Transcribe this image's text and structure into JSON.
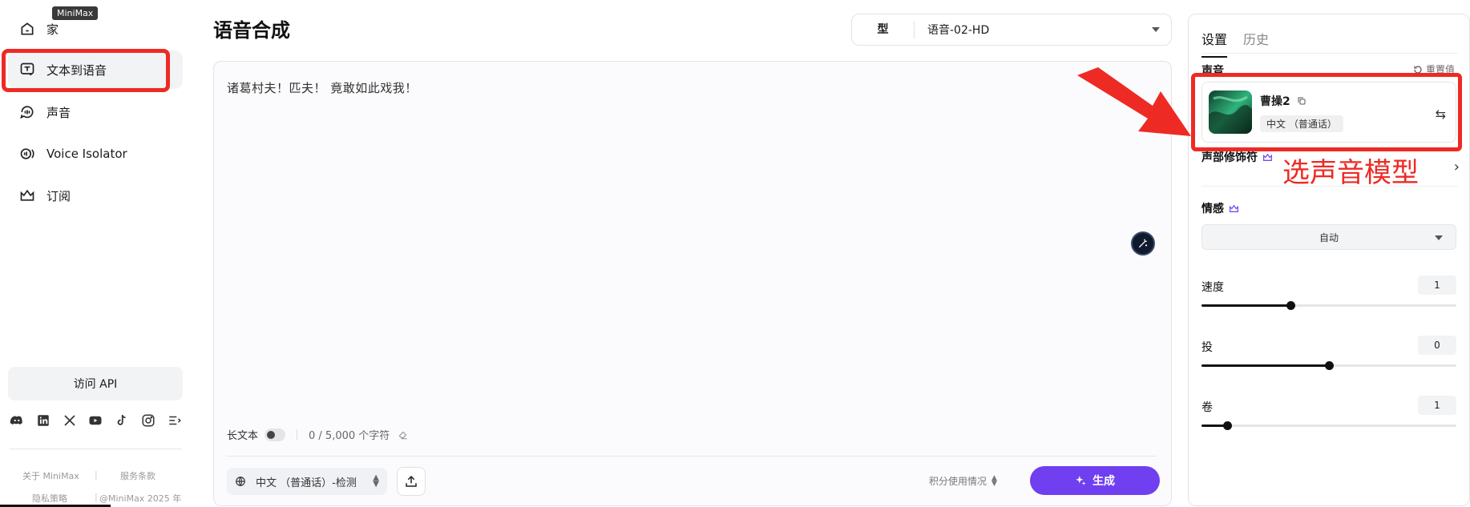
{
  "tooltip": "MiniMax",
  "nav": [
    {
      "label": "家",
      "icon": "home-icon"
    },
    {
      "label": "文本到语音",
      "icon": "text-to-speech-icon"
    },
    {
      "label": "声音",
      "icon": "voice-icon"
    },
    {
      "label": "Voice Isolator",
      "icon": "voice-isolator-icon"
    },
    {
      "label": "订阅",
      "icon": "crown-icon"
    }
  ],
  "api_button": "访问 API",
  "socials": [
    "discord-icon",
    "linkedin-icon",
    "x-icon",
    "youtube-icon",
    "tiktok-icon",
    "instagram-icon",
    "more-icon"
  ],
  "footer": {
    "about": "关于 MiniMax",
    "terms": "服务条款",
    "privacy": "隐私策略",
    "copyright": "@MiniMax 2025 年"
  },
  "main": {
    "title": "语音合成",
    "model_label": "型",
    "model_value": "语音-02-HD",
    "text": "诸葛村夫！匹夫！ 竟敢如此戏我！",
    "long_text_label": "长文本",
    "long_text_enabled": false,
    "char_count": "0 / 5,000 个字符",
    "language": "中文 （普通话）-检测",
    "credits": "积分使用情况",
    "generate": "生成"
  },
  "panel": {
    "tabs": [
      "设置",
      "历史"
    ],
    "active_tab": "设置",
    "voice_label": "声音",
    "reset": "重置值",
    "voice_name": "曹操2",
    "voice_lang": "中文 （普通话）",
    "modifier_label": "声部修饰符",
    "emotion_label": "情感",
    "emotion_value": "自动",
    "speed_label": "速度",
    "speed_value": "1",
    "speed_level": 0.35,
    "pitch_label": "投",
    "pitch_value": "0",
    "pitch_level": 0.5,
    "volume_label": "卷",
    "volume_value": "1",
    "volume_level": 0.1
  },
  "annotation": "选声音模型",
  "colors": {
    "accent": "#6f3ff0",
    "annotation": "#ee2a24"
  }
}
